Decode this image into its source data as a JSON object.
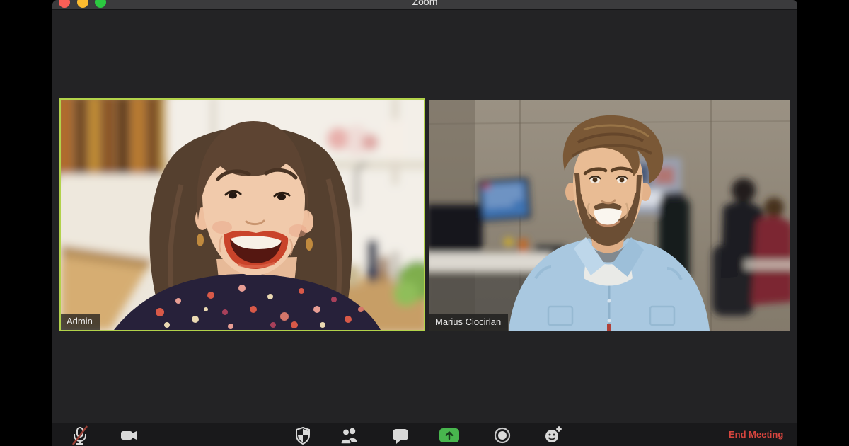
{
  "window": {
    "app_title": "Zoom",
    "controls": [
      {
        "name": "close"
      },
      {
        "name": "minimize"
      },
      {
        "name": "fullscreen"
      }
    ]
  },
  "meeting": {
    "participants": [
      {
        "name": "Admin",
        "active_speaker": true
      },
      {
        "name": "Marius Ciocirlan",
        "active_speaker": false
      }
    ]
  },
  "toolbar": {
    "buttons": [
      {
        "id": "mute",
        "icon": "microphone-muted-icon",
        "state": "muted"
      },
      {
        "id": "video",
        "icon": "video-camera-icon"
      },
      {
        "id": "security",
        "icon": "security-shield-icon"
      },
      {
        "id": "participants",
        "icon": "participants-icon"
      },
      {
        "id": "chat",
        "icon": "chat-bubble-icon"
      },
      {
        "id": "share-screen",
        "icon": "share-screen-icon"
      },
      {
        "id": "record",
        "icon": "record-icon"
      },
      {
        "id": "reactions",
        "icon": "reactions-icon"
      }
    ],
    "end_meeting_label": "End Meeting"
  },
  "colors": {
    "active_speaker_border": "#b2d24a",
    "share_screen_green": "#48b64e",
    "end_meeting_red": "#d6453e",
    "titlebar": "#3b3b3d",
    "content_background": "#232325",
    "toolbar_background": "#19191b",
    "traffic_red": "#f95f57",
    "traffic_yellow": "#fcbb2f",
    "traffic_green": "#2bc840"
  }
}
